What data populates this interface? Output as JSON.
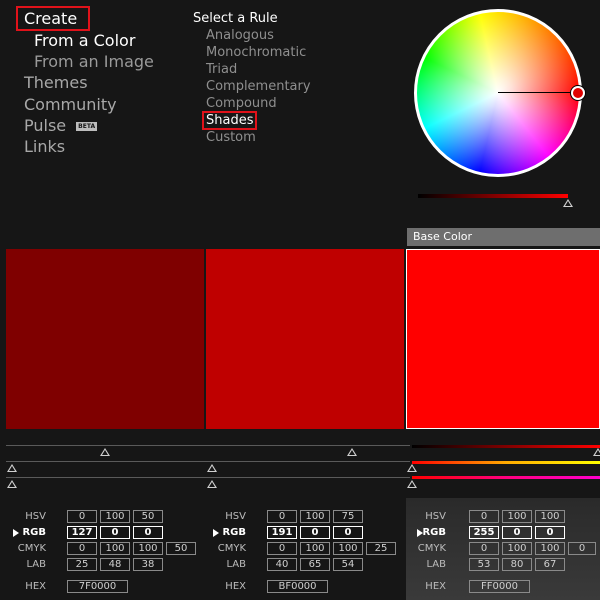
{
  "nav": {
    "create": "Create",
    "from_color": "From a Color",
    "from_image": "From an Image",
    "themes": "Themes",
    "community": "Community",
    "pulse": "Pulse",
    "pulse_badge": "BETA",
    "links": "Links"
  },
  "rules": {
    "title": "Select a Rule",
    "items": [
      "Analogous",
      "Monochromatic",
      "Triad",
      "Complementary",
      "Compound",
      "Shades",
      "Custom"
    ],
    "selected": "Shades"
  },
  "wheel": {
    "handle_color": "#e00000"
  },
  "base_label": "Base Color",
  "swatches": [
    {
      "color": "#7F0000"
    },
    {
      "color": "#BF0000"
    },
    {
      "color": "#FF0000"
    }
  ],
  "labels": {
    "hsv": "HSV",
    "rgb": "RGB",
    "cmyk": "CMYK",
    "lab": "LAB",
    "hex": "HEX"
  },
  "panels": [
    {
      "hsv": [
        "0",
        "100",
        "50"
      ],
      "rgb": [
        "127",
        "0",
        "0"
      ],
      "cmyk": [
        "0",
        "100",
        "100",
        "50"
      ],
      "lab": [
        "25",
        "48",
        "38"
      ],
      "hex": "7F0000"
    },
    {
      "hsv": [
        "0",
        "100",
        "75"
      ],
      "rgb": [
        "191",
        "0",
        "0"
      ],
      "cmyk": [
        "0",
        "100",
        "100",
        "25"
      ],
      "lab": [
        "40",
        "65",
        "54"
      ],
      "hex": "BF0000"
    },
    {
      "hsv": [
        "0",
        "100",
        "100"
      ],
      "rgb": [
        "255",
        "0",
        "0"
      ],
      "cmyk": [
        "0",
        "100",
        "100",
        "0"
      ],
      "lab": [
        "53",
        "80",
        "67"
      ],
      "hex": "FF0000"
    }
  ]
}
